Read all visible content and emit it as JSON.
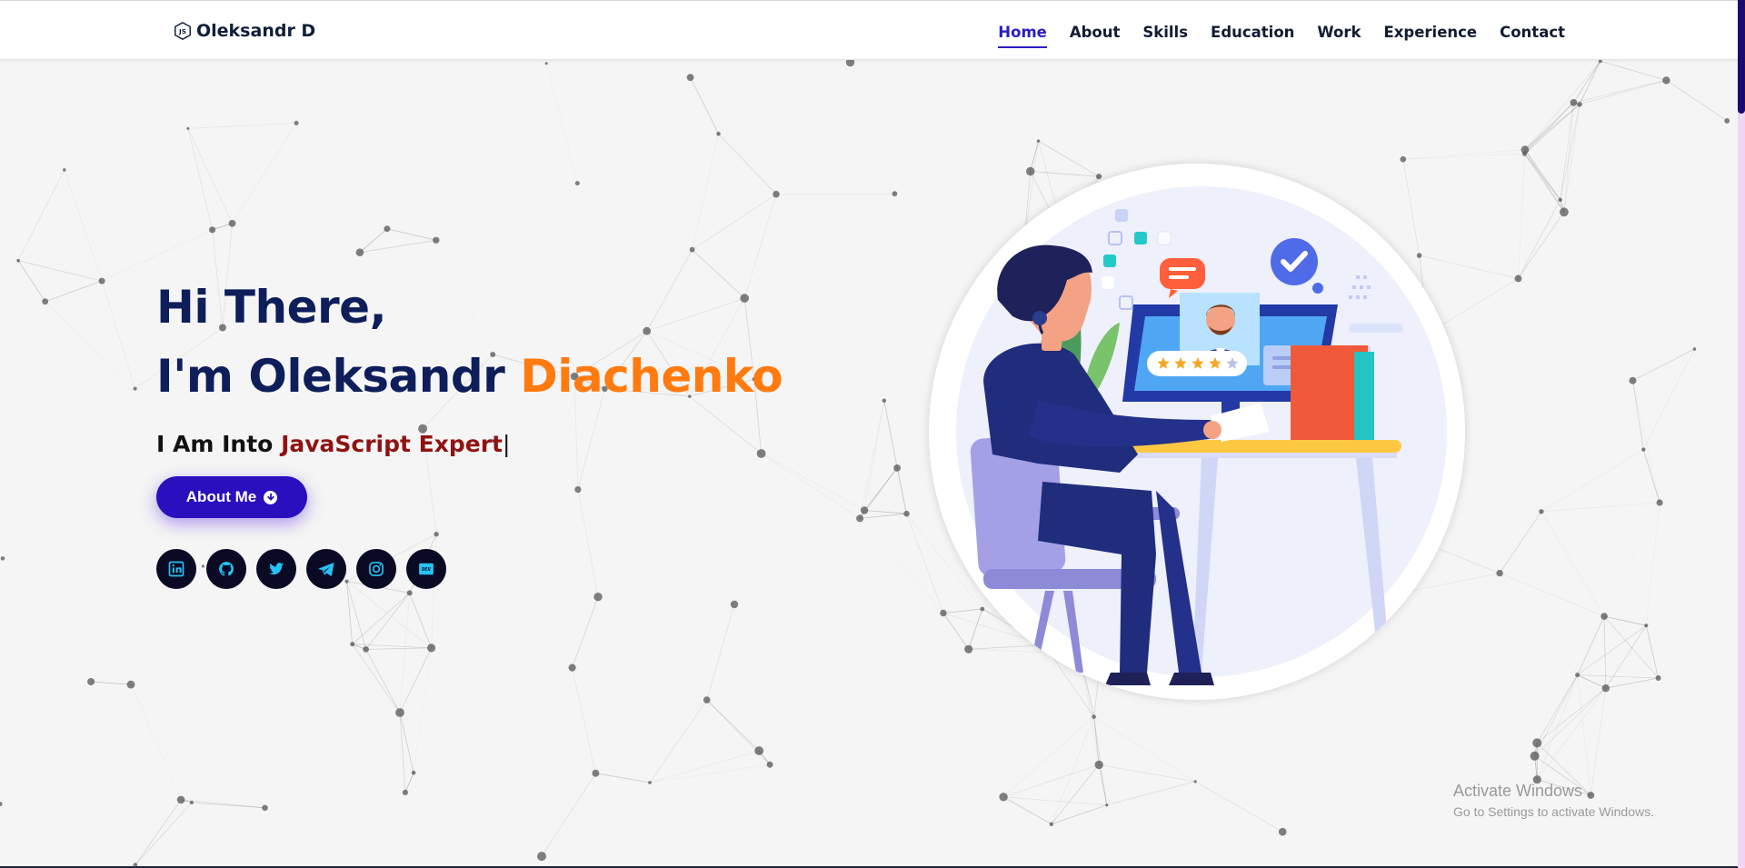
{
  "brand": {
    "name": "Oleksandr D",
    "logo_icon": "js-hexagon-icon"
  },
  "nav": {
    "items": [
      {
        "label": "Home",
        "active": true
      },
      {
        "label": "About",
        "active": false
      },
      {
        "label": "Skills",
        "active": false
      },
      {
        "label": "Education",
        "active": false
      },
      {
        "label": "Work",
        "active": false
      },
      {
        "label": "Experience",
        "active": false
      },
      {
        "label": "Contact",
        "active": false
      }
    ]
  },
  "hero": {
    "greeting": "Hi There,",
    "name_prefix": "I'm Oleksandr",
    "name_accent": "Diachenko",
    "typed_prefix": "I Am Into",
    "typed_highlight": "JavaScript Expert",
    "typed_cursor": "|",
    "about_button": "About Me",
    "about_icon": "arrow-circle-down-icon"
  },
  "social_links": [
    {
      "name": "linkedin",
      "icon": "linkedin-icon"
    },
    {
      "name": "github",
      "icon": "github-icon"
    },
    {
      "name": "twitter",
      "icon": "twitter-icon"
    },
    {
      "name": "telegram",
      "icon": "telegram-icon"
    },
    {
      "name": "instagram",
      "icon": "instagram-icon"
    },
    {
      "name": "dev",
      "icon": "dev-icon",
      "label": "DEV"
    }
  ],
  "watermark": {
    "title": "Activate Windows",
    "subtitle": "Go to Settings to activate Windows."
  },
  "colors": {
    "primary_navy": "#0e1e5b",
    "accent_orange": "#ff7a0f",
    "typed_red": "#8f1313",
    "button_purple": "#2a0fbf",
    "nav_active": "#2a1dc4",
    "social_bg": "#0a0a24",
    "social_icon": "#25c3f5"
  },
  "illustration": {
    "rating_stars": 4,
    "rating_max": 5
  }
}
